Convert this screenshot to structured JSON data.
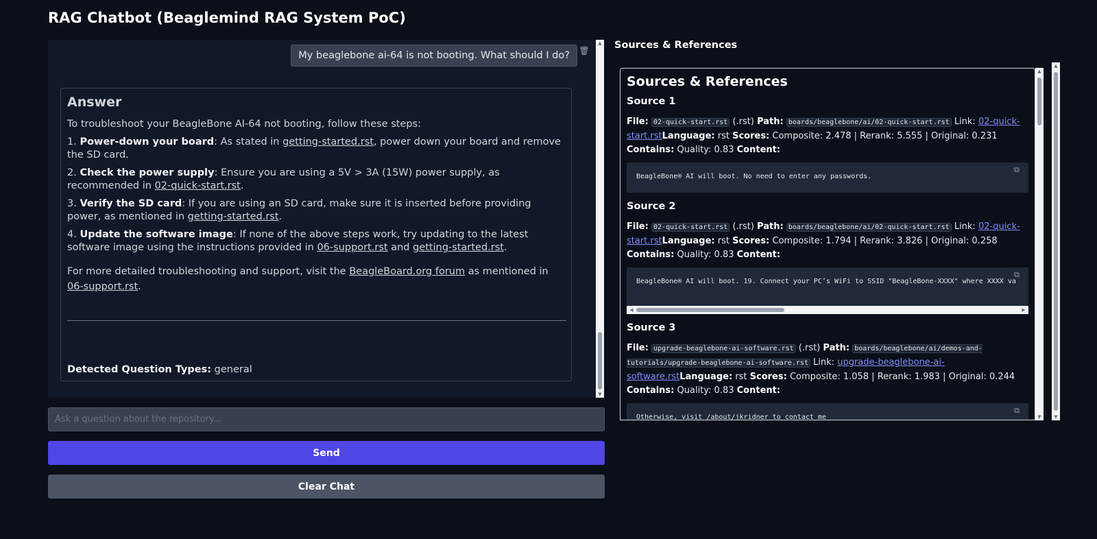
{
  "app": {
    "title": "RAG Chatbot (Beaglemind RAG System PoC)"
  },
  "chat": {
    "user_message": "My beaglebone ai-64 is not booting. What should I do?",
    "answer": {
      "heading": "Answer",
      "intro": "To troubleshoot your BeagleBone AI-64 not booting, follow these steps:",
      "steps": [
        {
          "num": "1.",
          "title": "Power-down your board",
          "text_a": ": As stated in ",
          "link_a": "getting-started.rst",
          "text_b": ", power down your board and remove the SD card.",
          "link_b": "",
          "text_c": ""
        },
        {
          "num": "2.",
          "title": "Check the power supply",
          "text_a": ": Ensure you are using a 5V > 3A (15W) power supply, as recommended in ",
          "link_a": "02-quick-start.rst",
          "text_b": ".",
          "link_b": "",
          "text_c": ""
        },
        {
          "num": "3.",
          "title": "Verify the SD card",
          "text_a": ": If you are using an SD card, make sure it is inserted before providing power, as mentioned in ",
          "link_a": "getting-started.rst",
          "text_b": ".",
          "link_b": "",
          "text_c": ""
        },
        {
          "num": "4.",
          "title": "Update the software image",
          "text_a": ": If none of the above steps work, try updating to the latest software image using the instructions provided in ",
          "link_a": "06-support.rst",
          "text_b": " and ",
          "link_b": "getting-started.rst",
          "text_c": "."
        }
      ],
      "outro_a": "For more detailed troubleshooting and support, visit the ",
      "outro_link_a": "BeagleBoard.org forum",
      "outro_b": " as mentioned in ",
      "outro_link_b": "06-support.rst",
      "outro_c": ".",
      "question_types_label": "Detected Question Types:",
      "question_types_value": " general"
    }
  },
  "input": {
    "placeholder": "Ask a question about the repository..."
  },
  "buttons": {
    "send": "Send",
    "clear": "Clear Chat"
  },
  "sources": {
    "label": "Sources & References",
    "heading": "Sources & References",
    "items": [
      {
        "title": "Source 1",
        "file": "02-quick-start.rst",
        "ext": " (.rst) ",
        "path": "boards/beaglebone/ai/02-quick-start.rst",
        "link": "02-quick-start.rst",
        "language": " rst ",
        "scores": " Composite: 2.478 | Rerank: 5.555 | Original: 0.231 ",
        "quality": "Quality: 0.83 ",
        "content": "BeagleBone® AI will boot. No need to enter any passwords."
      },
      {
        "title": "Source 2",
        "file": "02-quick-start.rst",
        "ext": " (.rst) ",
        "path": "boards/beaglebone/ai/02-quick-start.rst",
        "link": "02-quick-start.rst",
        "language": " rst ",
        "scores": " Composite: 1.794 | Rerank: 3.826 | Original: 0.258 ",
        "quality": "Quality: 0.83 ",
        "content": "BeagleBone® AI will boot. 19. Connect your PC’s WiFi to SSID \"BeagleBone-XXXX\" where XXXX va"
      },
      {
        "title": "Source 3",
        "file": "upgrade-beaglebone-ai-software.rst",
        "ext": " (.rst) ",
        "path": "boards/beaglebone/ai/demos-and-tutorials/upgrade-beaglebone-ai-software.rst",
        "link": "upgrade-beaglebone-ai-software.rst",
        "language": " rst ",
        "scores": " Composite: 1.058 | Rerank: 1.983 | Original: 0.244 ",
        "quality": "Quality: 0.83 ",
        "content": "Otherwise, visit /about/jkridner to contact me"
      }
    ],
    "labels": {
      "file": "File:",
      "path": "Path:",
      "link": "Link:",
      "language": "Language:",
      "scores": "Scores:",
      "contains": "Contains:",
      "content": "Content:"
    }
  },
  "icons": {
    "delete": "trash-icon",
    "copy": "copy-icon"
  }
}
